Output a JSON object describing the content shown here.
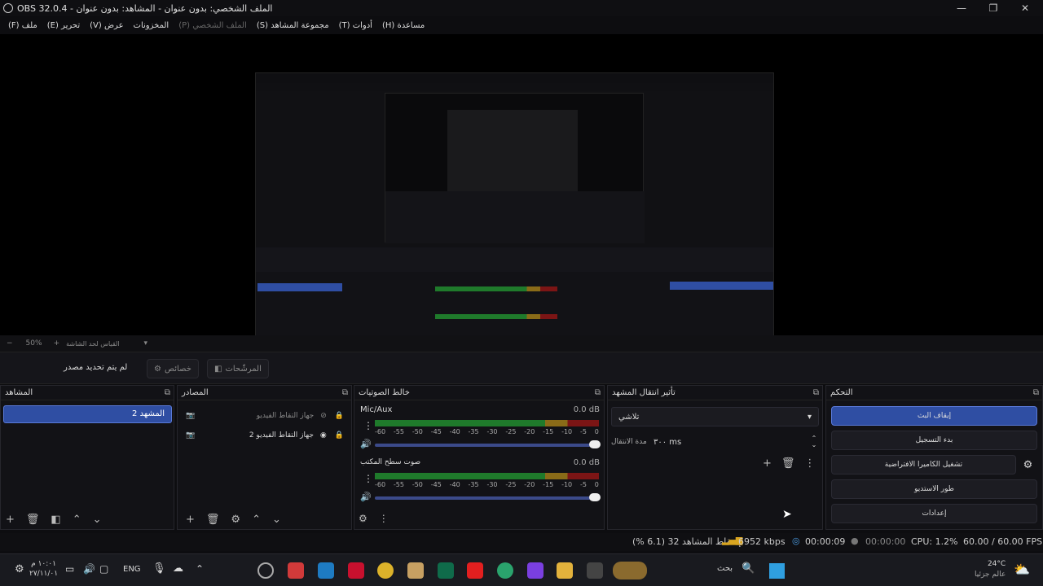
{
  "window": {
    "title": "OBS 32.0.4 - الملف الشخصي: بدون عنوان - المشاهد: بدون عنوان",
    "minimize": "—",
    "maximize": "❐",
    "close": "✕"
  },
  "menu": [
    {
      "label": "(F) ملف",
      "dim": false
    },
    {
      "label": "(E) تحرير",
      "dim": false
    },
    {
      "label": "(V) عرض",
      "dim": false
    },
    {
      "label": "المخزونات",
      "dim": false
    },
    {
      "label": "(P) الملف الشخصي",
      "dim": true
    },
    {
      "label": "(S) مجموعة المشاهد",
      "dim": false
    },
    {
      "label": "(T) أدوات",
      "dim": false
    },
    {
      "label": "(H) مساعدة",
      "dim": false
    }
  ],
  "zoom": {
    "minus": "−",
    "value": "50%",
    "plus": "+",
    "hint": "القياس لحد الشاشة"
  },
  "source_bar": {
    "no_source": "لم يتم تحديد مصدر",
    "properties": "خصائص",
    "filters": "المرشّحات"
  },
  "docks": {
    "scenes": {
      "title": "المشاهد",
      "items": [
        "المشهد 2"
      ]
    },
    "sources": {
      "title": "المصادر",
      "items": [
        {
          "name": "جهاز التقاط الفيديو",
          "dim": true
        },
        {
          "name": "جهاز التقاط الفيديو 2",
          "dim": false
        }
      ]
    },
    "mixer": {
      "title": "خالط الصوتيات",
      "tracks": [
        {
          "name": "Mic/Aux",
          "db": "0.0 dB"
        },
        {
          "name": "صوت سطح المكتب",
          "db": "0.0 dB"
        }
      ],
      "ticks": [
        "-60",
        "-55",
        "-50",
        "-45",
        "-40",
        "-35",
        "-30",
        "-25",
        "-20",
        "-15",
        "-10",
        "-5",
        "0"
      ]
    },
    "transitions": {
      "title": "تأثير انتقال المشهد",
      "type": "تلاشي",
      "duration_label": "مدة الانتقال",
      "duration_value": "٣٠٠ ms"
    },
    "controls": {
      "title": "التحكم",
      "buttons": [
        "إيقاف البث",
        "بدء التسجيل",
        "تشغيل الكاميرا الافتراضية",
        "طور الاستديو",
        "إعدادات"
      ]
    }
  },
  "status": {
    "dropped": "إسقاط المشاهد 32 (6.1 %)",
    "kbps": "6952 kbps",
    "stream_time": "00:00:09",
    "rec_time": "00:00:00",
    "cpu": "CPU: 1.2%",
    "fps": "60.00 / 60.00 FPS"
  },
  "taskbar": {
    "weather_temp": "24°C",
    "weather_desc": "عالم جزئيا",
    "search": "بحث",
    "lang": "ENG",
    "time": "١٠:٠١ م",
    "date": "٢٧/١١/٠١"
  },
  "colors": {
    "accent": "#2f4ea3",
    "meter_green": "#1f7a2b",
    "meter_yellow": "#8a6b18",
    "meter_red": "#7c1515"
  }
}
